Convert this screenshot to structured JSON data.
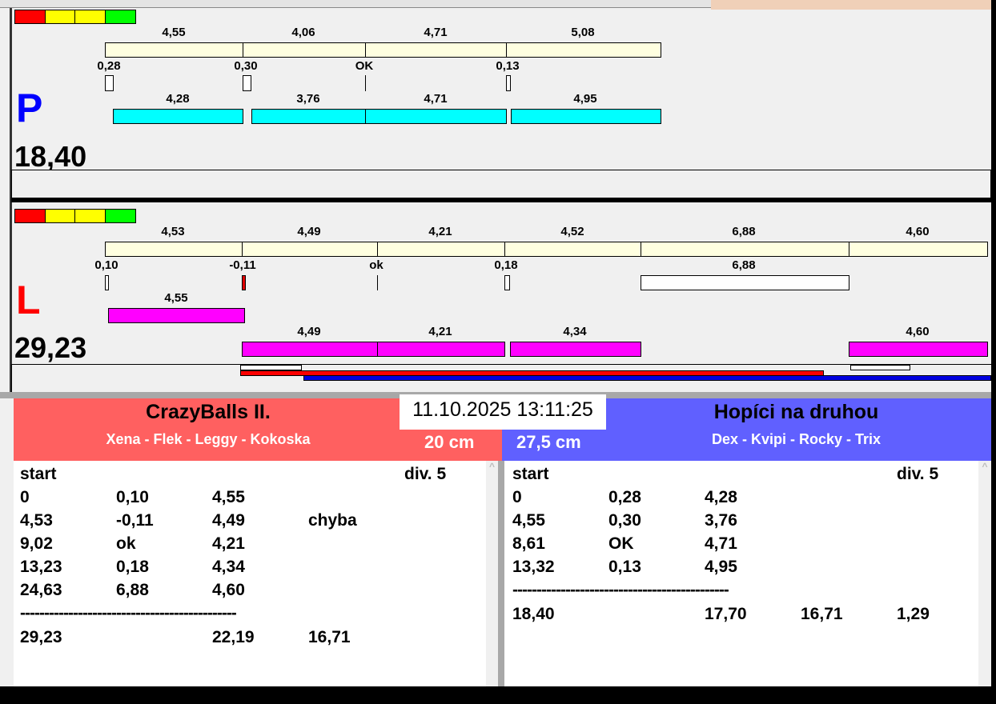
{
  "legend_colors": [
    "#ff0000",
    "#ffff00",
    "#ffff00",
    "#00ff00"
  ],
  "right_panel": {
    "letter": "P",
    "total": "18,40",
    "top_bars": [
      "4,55",
      "4,06",
      "4,71",
      "5,08"
    ],
    "deviations": [
      "0,28",
      "0,30",
      "OK",
      "0,13"
    ],
    "bottom_bars": [
      "4,28",
      "3,76",
      "4,71",
      "4,95"
    ]
  },
  "left_panel": {
    "letter": "L",
    "total": "29,23",
    "top_bars": [
      "4,53",
      "4,49",
      "4,21",
      "4,52",
      "6,88",
      "4,60"
    ],
    "deviations": [
      "0,10",
      "-0,11",
      "ok",
      "0,18",
      "6,88"
    ],
    "extra_bar": "4,55",
    "bottom_bars": [
      "4,49",
      "4,21",
      "4,34",
      "4,60"
    ]
  },
  "datetime": "11.10.2025 13:11:25",
  "team_left": {
    "name": "CrazyBalls II.",
    "players": "Xena - Flek - Leggy - Kokoska",
    "distance": "20 cm",
    "color": "#ff6060"
  },
  "team_right": {
    "name": "Hopíci na druhou",
    "players": "Dex - Kvipi - Rocky - Trix",
    "distance": "27,5 cm",
    "color": "#6060ff"
  },
  "log_left": {
    "header": [
      "start",
      "div.  5"
    ],
    "rows": [
      [
        "0",
        "0,10",
        "4,55",
        ""
      ],
      [
        "4,53",
        "-0,11",
        "4,49",
        "chyba"
      ],
      [
        "9,02",
        "ok",
        "4,21",
        ""
      ],
      [
        "13,23",
        "0,18",
        "4,34",
        ""
      ],
      [
        "24,63",
        "6,88",
        "4,60",
        ""
      ]
    ],
    "separator": "---------------------------------------------",
    "totals": [
      "29,23",
      "22,19",
      "16,71"
    ]
  },
  "log_right": {
    "header": [
      "start",
      "div.  5"
    ],
    "rows": [
      [
        "0",
        "0,28",
        "4,28"
      ],
      [
        "4,55",
        "0,30",
        "3,76"
      ],
      [
        "8,61",
        "OK",
        "4,71"
      ],
      [
        "13,32",
        "0,13",
        "4,95"
      ]
    ],
    "separator": "---------------------------------------------",
    "totals": [
      "18,40",
      "17,70",
      "16,71",
      "1,29"
    ]
  }
}
